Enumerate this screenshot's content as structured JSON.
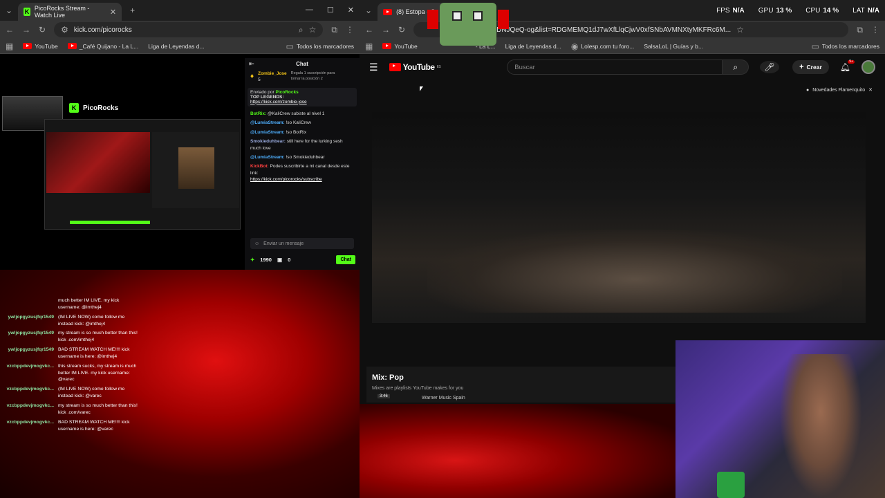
{
  "left_browser": {
    "tab_title": "PicoRocks Stream - Watch Live",
    "url": "kick.com/picorocks",
    "bookmarks": [
      "YouTube",
      "_Café Quijano - La L...",
      "Liga de Leyendas d..."
    ],
    "all_bookmarks": "Todos los marcadores"
  },
  "right_browser": {
    "tab_title": "(8) Estopa - C",
    "url": "DNJQeQ-og&list=RDGMEMQ1dJ7wXfLlqCjwV0xfSNbAVMNXtyMKFRc6M...",
    "bookmarks": [
      "YouTube",
      "- La L...",
      "Liga de Leyendas d...",
      "Lolesp.com tu foro...",
      "SalsaLoL | Guías y b..."
    ],
    "all_bookmarks": "Todos los marcadores"
  },
  "stats": {
    "fps_label": "FPS",
    "fps_value": "N/A",
    "gpu_label": "GPU",
    "gpu_value": "13 %",
    "cpu_label": "CPU",
    "cpu_value": "14 %",
    "lat_label": "LAT",
    "lat_value": "N/A"
  },
  "stream": {
    "channel_name": "PicoRocks"
  },
  "kick_chat": {
    "title": "Chat",
    "top_gifter": "Zombie_Jose",
    "top_gifter_count": "5",
    "gift_note": "Regala 1 suscripción para tomar la posición 2",
    "pinned_by": "Enviado por",
    "pinned_user": "PicoRocks",
    "pinned_title": "TOP LEGENDS:",
    "pinned_link": "https://kick.com/zombie-jose",
    "messages": [
      {
        "user": "BotRix:",
        "text": "@KaliCrew subiste al nivel 1"
      },
      {
        "user": "@LumiaStream:",
        "text": "!so KaliCrew"
      },
      {
        "user": "@LumiaStream:",
        "text": "!so BotRix"
      },
      {
        "user": "Smokieduhbear:",
        "text": "still here for the lurking sesh much love"
      },
      {
        "user": "@LumiaStream:",
        "text": "!so Smokieduhbear"
      },
      {
        "user": "KickBot:",
        "text": "Podes suscribirte a mi canal desde este link:"
      }
    ],
    "sub_link": "https://kick.com/picorocks/subscribe",
    "input_placeholder": "Enviar un mensaje",
    "points": "1990",
    "gifts": "0",
    "send_button": "Chat"
  },
  "bot_chat": [
    {
      "name": "",
      "text": "much better IM LIVE. my kick username: @imthej4"
    },
    {
      "name": "ywljopgyzusjfqr1549",
      "text": "(IM LIVE NOW) come follow me instead kick: @imthej4"
    },
    {
      "name": "ywljopgyzusjfqr1549",
      "text": "my stream is so much better than this! kick .com/imthej4"
    },
    {
      "name": "ywljopgyzusjfqr1549",
      "text": "BAD STREAM WATCH ME!!!! kick username is here: @imthej4"
    },
    {
      "name": "vzcbppdevjmogvkc...",
      "text": "this stream sucks, my stream is much better IM LIVE. my kick username: @varec"
    },
    {
      "name": "vzcbppdevjmogvkc...",
      "text": "(IM LIVE NOW) come follow me instead kick: @varec"
    },
    {
      "name": "vzcbppdevjmogvkc...",
      "text": "my stream is so much better than this! kick .com/varec"
    },
    {
      "name": "vzcbppdevjmogvkc...",
      "text": "BAD STREAM WATCH ME!!!! kick username is here: @varec"
    }
  ],
  "youtube": {
    "logo_text": "YouTube",
    "region": "ES",
    "search_placeholder": "Buscar",
    "create_label": "Crear",
    "notif_count": "9+",
    "notice": "Novedades Flamenquito",
    "mix_title": "Mix: Pop",
    "mix_subtitle": "Mixes are playlists YouTube makes for you",
    "mix_item_duration": "3:46",
    "mix_item_channel": "Warner Music Spain"
  },
  "colors": {
    "kick_green": "#53fc18",
    "youtube_red": "#ff0000"
  }
}
